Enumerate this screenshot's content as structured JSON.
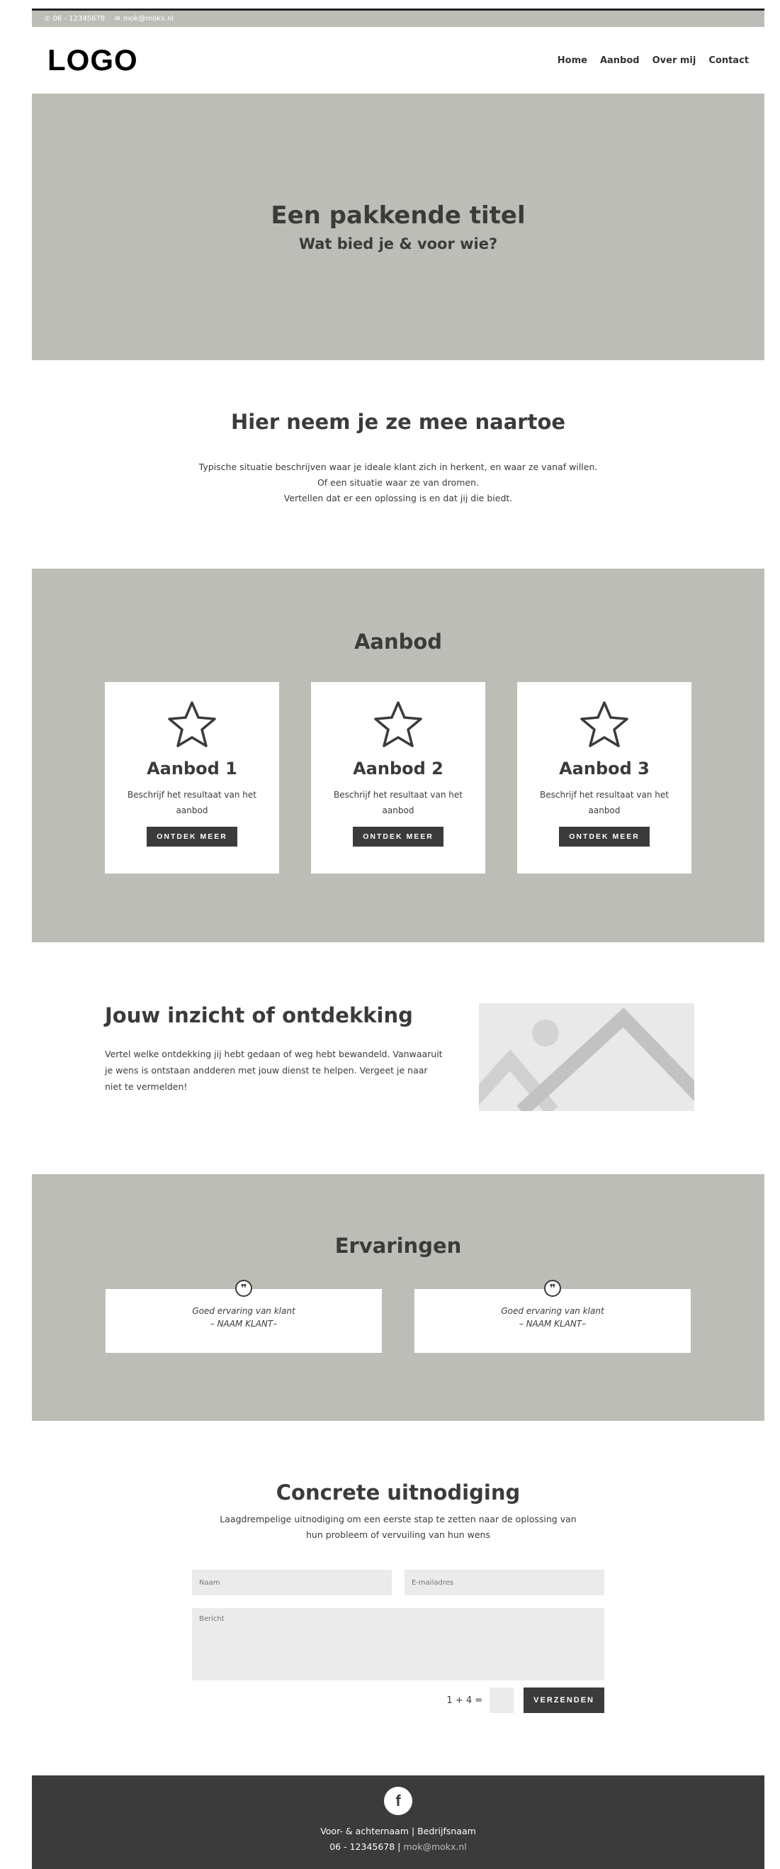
{
  "topbar": {
    "phone": "06 - 12345678",
    "email": "mok@mokx.nl"
  },
  "header": {
    "logo": "LOGO",
    "nav": [
      "Home",
      "Aanbod",
      "Over mij",
      "Contact"
    ]
  },
  "hero": {
    "title": "Een pakkende titel",
    "subtitle": "Wat bied je & voor wie?"
  },
  "intro": {
    "title": "Hier neem je ze mee naartoe",
    "lines": [
      "Typische situatie beschrijven waar je ideale klant zich in herkent, en waar ze vanaf willen.",
      "Of een situatie waar ze van dromen.",
      "Vertellen dat er een oplossing is en dat jij die biedt."
    ]
  },
  "aanbod": {
    "title": "Aanbod",
    "cards": [
      {
        "title": "Aanbod 1",
        "text": "Beschrijf het resultaat van het aanbod",
        "button": "ONTDEK MEER"
      },
      {
        "title": "Aanbod 2",
        "text": "Beschrijf het resultaat van het aanbod",
        "button": "ONTDEK MEER"
      },
      {
        "title": "Aanbod 3",
        "text": "Beschrijf het resultaat van het aanbod",
        "button": "ONTDEK MEER"
      }
    ]
  },
  "inzicht": {
    "title": "Jouw inzicht of ontdekking",
    "text": "Vertel welke ontdekking jij hebt gedaan of weg hebt bewandeld. Vanwaaruit je wens is ontstaan andderen met jouw dienst te helpen. Vergeet je naar niet te vermelden!"
  },
  "ervaringen": {
    "title": "Ervaringen",
    "quotes": [
      {
        "text": "Goed ervaring van klant",
        "author": "– NAAM KLANT–"
      },
      {
        "text": "Goed ervaring van klant",
        "author": "– NAAM KLANT–"
      }
    ]
  },
  "cta": {
    "title": "Concrete uitnodiging",
    "desc": "Laagdrempelige uitnodiging om een eerste stap te zetten naar de oplossing van hun probleem of vervuiling van hun wens",
    "name_placeholder": "Naam",
    "email_placeholder": "E-mailadres",
    "message_placeholder": "Bericht",
    "captcha": "1 + 4 =",
    "send": "VERZENDEN"
  },
  "footer": {
    "facebook": "f",
    "name": "Voor- & achternaam | Bedrijfsnaam",
    "phone": "06 - 12345678 |",
    "email": "mok@mokx.nl"
  }
}
